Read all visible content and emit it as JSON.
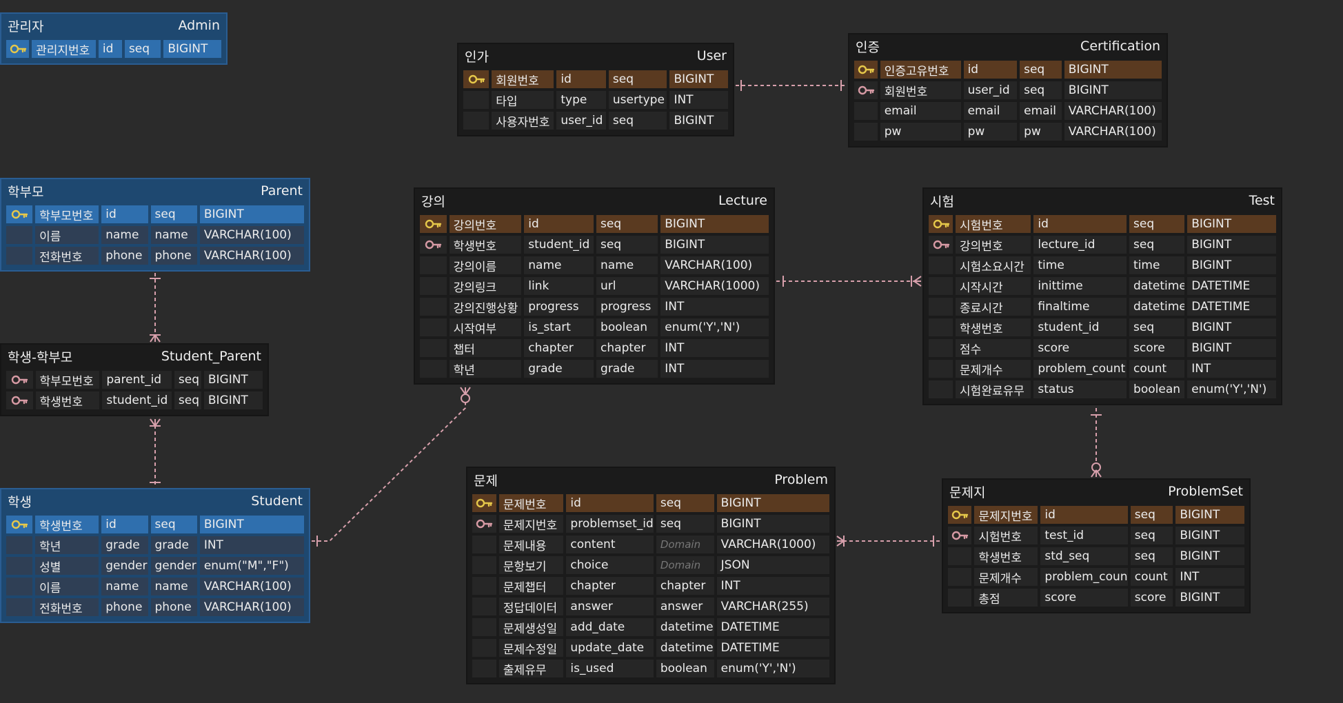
{
  "colors": {
    "background": "#2b2b2b",
    "blue_table": "#1e4870",
    "blue_pk_row": "#2f6fae",
    "dark_table": "#1b1b1b",
    "dark_pk_row": "#5a3a20",
    "pk_icon": "#e6c84a",
    "fk_icon": "#d79aa4",
    "relation_line": "#d8a0ac"
  },
  "entities": {
    "admin": {
      "kor": "관리자",
      "eng": "Admin",
      "rows": [
        {
          "icon": "pk",
          "pk": true,
          "cells": [
            "관리지번호",
            "id",
            "seq",
            "BIGINT"
          ]
        }
      ]
    },
    "user": {
      "kor": "인가",
      "eng": "User",
      "rows": [
        {
          "icon": "pk",
          "pk": true,
          "cells": [
            "회원번호",
            "id",
            "seq",
            "BIGINT"
          ]
        },
        {
          "icon": "",
          "pk": false,
          "cells": [
            "타입",
            "type",
            "usertype",
            "INT"
          ]
        },
        {
          "icon": "",
          "pk": false,
          "cells": [
            "사용자번호",
            "user_id",
            "seq",
            "BIGINT"
          ]
        }
      ]
    },
    "certification": {
      "kor": "인증",
      "eng": "Certification",
      "rows": [
        {
          "icon": "pk",
          "pk": true,
          "cells": [
            "인증고유번호",
            "id",
            "seq",
            "BIGINT"
          ]
        },
        {
          "icon": "fk",
          "pk": false,
          "cells": [
            "회원번호",
            "user_id",
            "seq",
            "BIGINT"
          ]
        },
        {
          "icon": "",
          "pk": false,
          "cells": [
            "email",
            "email",
            "email",
            "VARCHAR(100)"
          ]
        },
        {
          "icon": "",
          "pk": false,
          "cells": [
            "pw",
            "pw",
            "pw",
            "VARCHAR(100)"
          ]
        }
      ]
    },
    "parent": {
      "kor": "학부모",
      "eng": "Parent",
      "rows": [
        {
          "icon": "pk",
          "pk": true,
          "cells": [
            "학부모번호",
            "id",
            "seq",
            "BIGINT"
          ]
        },
        {
          "icon": "",
          "pk": false,
          "cells": [
            "이름",
            "name",
            "name",
            "VARCHAR(100)"
          ]
        },
        {
          "icon": "",
          "pk": false,
          "cells": [
            "전화번호",
            "phone",
            "phone",
            "VARCHAR(100)"
          ]
        }
      ]
    },
    "lecture": {
      "kor": "강의",
      "eng": "Lecture",
      "rows": [
        {
          "icon": "pk",
          "pk": true,
          "cells": [
            "강의번호",
            "id",
            "seq",
            "BIGINT"
          ]
        },
        {
          "icon": "fk",
          "pk": false,
          "cells": [
            "학생번호",
            "student_id",
            "seq",
            "BIGINT"
          ]
        },
        {
          "icon": "",
          "pk": false,
          "cells": [
            "강의이름",
            "name",
            "name",
            "VARCHAR(100)"
          ]
        },
        {
          "icon": "",
          "pk": false,
          "cells": [
            "강의링크",
            "link",
            "url",
            "VARCHAR(1000)"
          ]
        },
        {
          "icon": "",
          "pk": false,
          "cells": [
            "강의진행상황",
            "progress",
            "progress",
            "INT"
          ]
        },
        {
          "icon": "",
          "pk": false,
          "cells": [
            "시작여부",
            "is_start",
            "boolean",
            "enum('Y','N')"
          ]
        },
        {
          "icon": "",
          "pk": false,
          "cells": [
            "챕터",
            "chapter",
            "chapter",
            "INT"
          ]
        },
        {
          "icon": "",
          "pk": false,
          "cells": [
            "학년",
            "grade",
            "grade",
            "INT"
          ]
        }
      ]
    },
    "test": {
      "kor": "시험",
      "eng": "Test",
      "rows": [
        {
          "icon": "pk",
          "pk": true,
          "cells": [
            "시험번호",
            "id",
            "seq",
            "BIGINT"
          ]
        },
        {
          "icon": "fk",
          "pk": false,
          "cells": [
            "강의번호",
            "lecture_id",
            "seq",
            "BIGINT"
          ]
        },
        {
          "icon": "",
          "pk": false,
          "cells": [
            "시험소요시간",
            "time",
            "time",
            "BIGINT"
          ]
        },
        {
          "icon": "",
          "pk": false,
          "cells": [
            "시작시간",
            "inittime",
            "datetime",
            "DATETIME"
          ]
        },
        {
          "icon": "",
          "pk": false,
          "cells": [
            "종료시간",
            "finaltime",
            "datetime",
            "DATETIME"
          ]
        },
        {
          "icon": "",
          "pk": false,
          "cells": [
            "학생번호",
            "student_id",
            "seq",
            "BIGINT"
          ]
        },
        {
          "icon": "",
          "pk": false,
          "cells": [
            "점수",
            "score",
            "score",
            "BIGINT"
          ]
        },
        {
          "icon": "",
          "pk": false,
          "cells": [
            "문제개수",
            "problem_count",
            "count",
            "INT"
          ]
        },
        {
          "icon": "",
          "pk": false,
          "cells": [
            "시험완료유무",
            "status",
            "boolean",
            "enum('Y','N')"
          ]
        }
      ]
    },
    "student_parent": {
      "kor": "학생-학부모",
      "eng": "Student_Parent",
      "rows": [
        {
          "icon": "fk",
          "pk": false,
          "cells": [
            "학부모번호",
            "parent_id",
            "seq",
            "BIGINT"
          ]
        },
        {
          "icon": "fk",
          "pk": false,
          "cells": [
            "학생번호",
            "student_id",
            "seq",
            "BIGINT"
          ]
        }
      ]
    },
    "student": {
      "kor": "학생",
      "eng": "Student",
      "rows": [
        {
          "icon": "pk",
          "pk": true,
          "cells": [
            "학생번호",
            "id",
            "seq",
            "BIGINT"
          ]
        },
        {
          "icon": "",
          "pk": false,
          "cells": [
            "학년",
            "grade",
            "grade",
            "INT"
          ]
        },
        {
          "icon": "",
          "pk": false,
          "cells": [
            "성별",
            "gender",
            "gender",
            "enum(\"M\",\"F\")"
          ]
        },
        {
          "icon": "",
          "pk": false,
          "cells": [
            "이름",
            "name",
            "name",
            "VARCHAR(100)"
          ]
        },
        {
          "icon": "",
          "pk": false,
          "cells": [
            "전화번호",
            "phone",
            "phone",
            "VARCHAR(100)"
          ]
        }
      ]
    },
    "problem": {
      "kor": "문제",
      "eng": "Problem",
      "rows": [
        {
          "icon": "pk",
          "pk": true,
          "cells": [
            "문제번호",
            "id",
            "seq",
            "BIGINT"
          ]
        },
        {
          "icon": "fk",
          "pk": false,
          "cells": [
            "문제지번호",
            "problemset_id",
            "seq",
            "BIGINT"
          ]
        },
        {
          "icon": "",
          "pk": false,
          "cells": [
            "문제내용",
            "content",
            "Domain",
            "VARCHAR(1000)"
          ]
        },
        {
          "icon": "",
          "pk": false,
          "cells": [
            "문항보기",
            "choice",
            "Domain",
            "JSON"
          ]
        },
        {
          "icon": "",
          "pk": false,
          "cells": [
            "문제챕터",
            "chapter",
            "chapter",
            "INT"
          ]
        },
        {
          "icon": "",
          "pk": false,
          "cells": [
            "정답데이터",
            "answer",
            "answer",
            "VARCHAR(255)"
          ]
        },
        {
          "icon": "",
          "pk": false,
          "cells": [
            "문제생성일",
            "add_date",
            "datetime",
            "DATETIME"
          ]
        },
        {
          "icon": "",
          "pk": false,
          "cells": [
            "문제수정일",
            "update_date",
            "datetime",
            "DATETIME"
          ]
        },
        {
          "icon": "",
          "pk": false,
          "cells": [
            "출제유무",
            "is_used",
            "boolean",
            "enum('Y','N')"
          ]
        }
      ]
    },
    "problemset": {
      "kor": "문제지",
      "eng": "ProblemSet",
      "rows": [
        {
          "icon": "pk",
          "pk": true,
          "cells": [
            "문제지번호",
            "id",
            "seq",
            "BIGINT"
          ]
        },
        {
          "icon": "fk",
          "pk": false,
          "cells": [
            "시험번호",
            "test_id",
            "seq",
            "BIGINT"
          ]
        },
        {
          "icon": "",
          "pk": false,
          "cells": [
            "학생번호",
            "std_seq",
            "seq",
            "BIGINT"
          ]
        },
        {
          "icon": "",
          "pk": false,
          "cells": [
            "문제개수",
            "problem_count",
            "count",
            "INT"
          ]
        },
        {
          "icon": "",
          "pk": false,
          "cells": [
            "총점",
            "score",
            "score",
            "BIGINT"
          ]
        }
      ]
    }
  },
  "relations": [
    {
      "from": "user",
      "to": "certification"
    },
    {
      "from": "lecture",
      "to": "test"
    },
    {
      "from": "parent",
      "to": "student_parent"
    },
    {
      "from": "student_parent",
      "to": "student"
    },
    {
      "from": "student",
      "to": "lecture"
    },
    {
      "from": "problem",
      "to": "problemset"
    },
    {
      "from": "test",
      "to": "problemset"
    }
  ]
}
